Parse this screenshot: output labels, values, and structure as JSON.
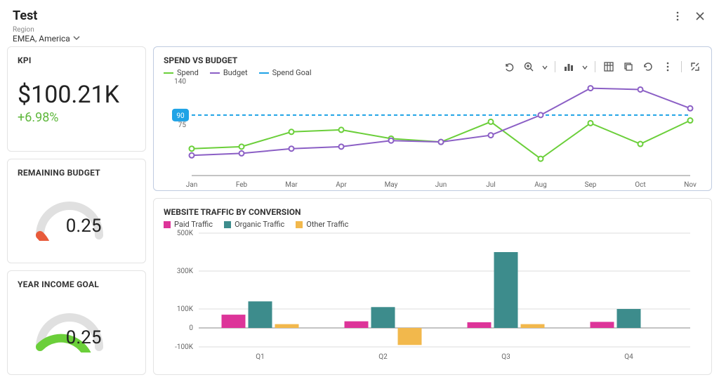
{
  "header": {
    "title": "Test",
    "region_label": "Region",
    "region_value": "EMEA, America"
  },
  "kpi": {
    "title": "KPI",
    "value": "$100.21K",
    "delta": "+6.98%"
  },
  "remaining_budget": {
    "title": "REMAINING BUDGET",
    "value": "0.25",
    "ratio": 0.25,
    "color": "#e85a3a"
  },
  "year_income_goal": {
    "title": "YEAR INCOME GOAL",
    "value": "0.25",
    "ratio": 0.75,
    "color": "#6bcf3a"
  },
  "spend_vs_budget": {
    "title": "SPEND VS BUDGET",
    "legend": {
      "spend": "Spend",
      "budget": "Budget",
      "goal": "Spend Goal"
    }
  },
  "traffic": {
    "title": "WEBSITE TRAFFIC BY CONVERSION",
    "legend": {
      "paid": "Paid Traffic",
      "organic": "Organic Traffic",
      "other": "Other Traffic"
    }
  },
  "chart_data": [
    {
      "id": "spend_vs_budget",
      "type": "line",
      "title": "SPEND VS BUDGET",
      "x": [
        "Jan",
        "Feb",
        "Mar",
        "Apr",
        "May",
        "Jun",
        "Jul",
        "Aug",
        "Sep",
        "Oct",
        "Nov"
      ],
      "series": [
        {
          "name": "Spend",
          "values": [
            40,
            43,
            65,
            68,
            55,
            50,
            80,
            25,
            78,
            47,
            82
          ],
          "color": "#6bcf3a"
        },
        {
          "name": "Budget",
          "values": [
            30,
            33,
            40,
            43,
            52,
            50,
            60,
            90,
            130,
            128,
            100
          ],
          "color": "#8b5fc5"
        }
      ],
      "goal": {
        "label": "90",
        "value": 90,
        "color": "#1fa3e6"
      },
      "ylim": [
        0,
        140
      ],
      "yticks": [
        75,
        140
      ],
      "xlabel": "",
      "ylabel": ""
    },
    {
      "id": "website_traffic",
      "type": "bar",
      "title": "WEBSITE TRAFFIC BY CONVERSION",
      "categories": [
        "Q1",
        "Q2",
        "Q3",
        "Q4"
      ],
      "series": [
        {
          "name": "Paid Traffic",
          "values": [
            70000,
            35000,
            30000,
            32000
          ],
          "color": "#dd3499"
        },
        {
          "name": "Organic Traffic",
          "values": [
            140000,
            110000,
            400000,
            100000
          ],
          "color": "#3d8c8c"
        },
        {
          "name": "Other Traffic",
          "values": [
            20000,
            -90000,
            20000,
            0
          ],
          "color": "#f2b84c"
        }
      ],
      "ylim": [
        -100000,
        500000
      ],
      "yticks": [
        -100000,
        0,
        100000,
        300000,
        500000
      ],
      "ytick_labels": [
        "-100K",
        "0",
        "100K",
        "300K",
        "500K"
      ],
      "xlabel": "",
      "ylabel": ""
    }
  ]
}
